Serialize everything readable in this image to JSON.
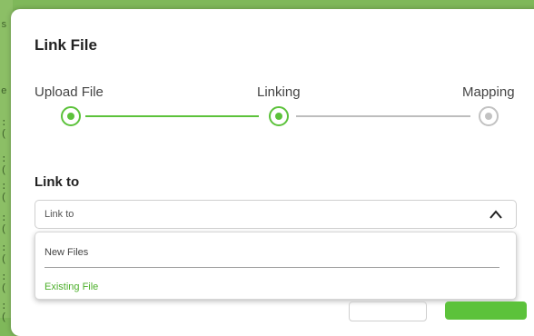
{
  "modal": {
    "title": "Link File"
  },
  "stepper": {
    "steps": [
      {
        "label": "Upload File",
        "state": "completed"
      },
      {
        "label": "Linking",
        "state": "active"
      },
      {
        "label": "Mapping",
        "state": "pending"
      }
    ]
  },
  "link_to": {
    "label": "Link to",
    "select_value": "Link to",
    "options": [
      "New Files",
      "Existing File"
    ],
    "highlighted_option": "Existing File"
  },
  "colors": {
    "accent": "#5cc23b",
    "inactive": "#c2c2c2",
    "background": "#7fb85a"
  },
  "icons": {
    "dropdown_toggle": "chevron-up-icon"
  }
}
